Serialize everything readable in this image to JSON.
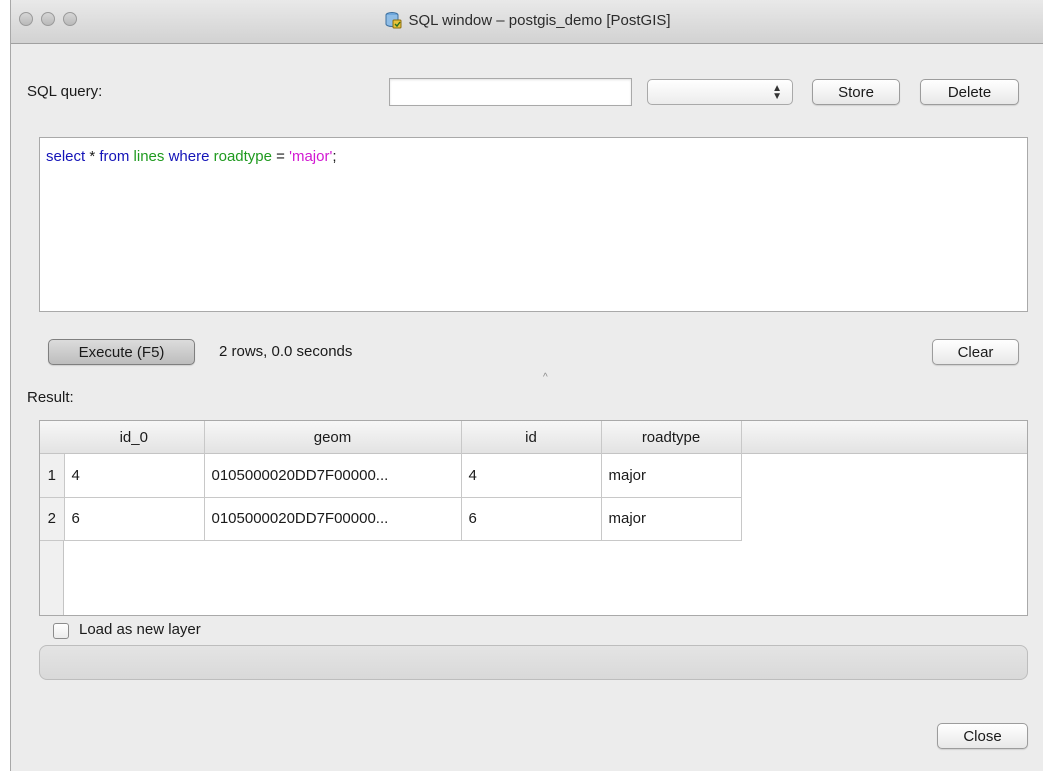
{
  "window": {
    "title": "SQL window – postgis_demo [PostGIS]",
    "icon": "database-sql-icon"
  },
  "query_bar": {
    "label": "SQL query:",
    "name_input_value": "",
    "stored_queries_selected": "",
    "store_label": "Store",
    "delete_label": "Delete"
  },
  "editor": {
    "tokens": [
      {
        "text": "select",
        "color": "#1414b8"
      },
      {
        "text": " * ",
        "color": "#1a1a1a"
      },
      {
        "text": "from",
        "color": "#1414b8"
      },
      {
        "text": " ",
        "color": "#1a1a1a"
      },
      {
        "text": "lines",
        "color": "#1f9a1f"
      },
      {
        "text": " ",
        "color": "#1a1a1a"
      },
      {
        "text": "where",
        "color": "#1414b8"
      },
      {
        "text": " ",
        "color": "#1a1a1a"
      },
      {
        "text": "roadtype",
        "color": "#1f9a1f"
      },
      {
        "text": " = ",
        "color": "#1a1a1a"
      },
      {
        "text": "'major'",
        "color": "#d21ad2"
      },
      {
        "text": ";",
        "color": "#1a1a1a"
      }
    ]
  },
  "execution": {
    "execute_label": "Execute (F5)",
    "status": "2 rows, 0.0 seconds",
    "clear_label": "Clear"
  },
  "results": {
    "label": "Result:",
    "columns": [
      "id_0",
      "geom",
      "id",
      "roadtype"
    ],
    "rows": [
      {
        "num": "1",
        "cells": [
          "4",
          "0105000020DD7F00000...",
          "4",
          "major"
        ]
      },
      {
        "num": "2",
        "cells": [
          "6",
          "0105000020DD7F00000...",
          "6",
          "major"
        ]
      }
    ]
  },
  "options": {
    "load_as_layer_label": "Load as new layer",
    "load_as_layer_checked": false
  },
  "footer": {
    "close_label": "Close"
  }
}
